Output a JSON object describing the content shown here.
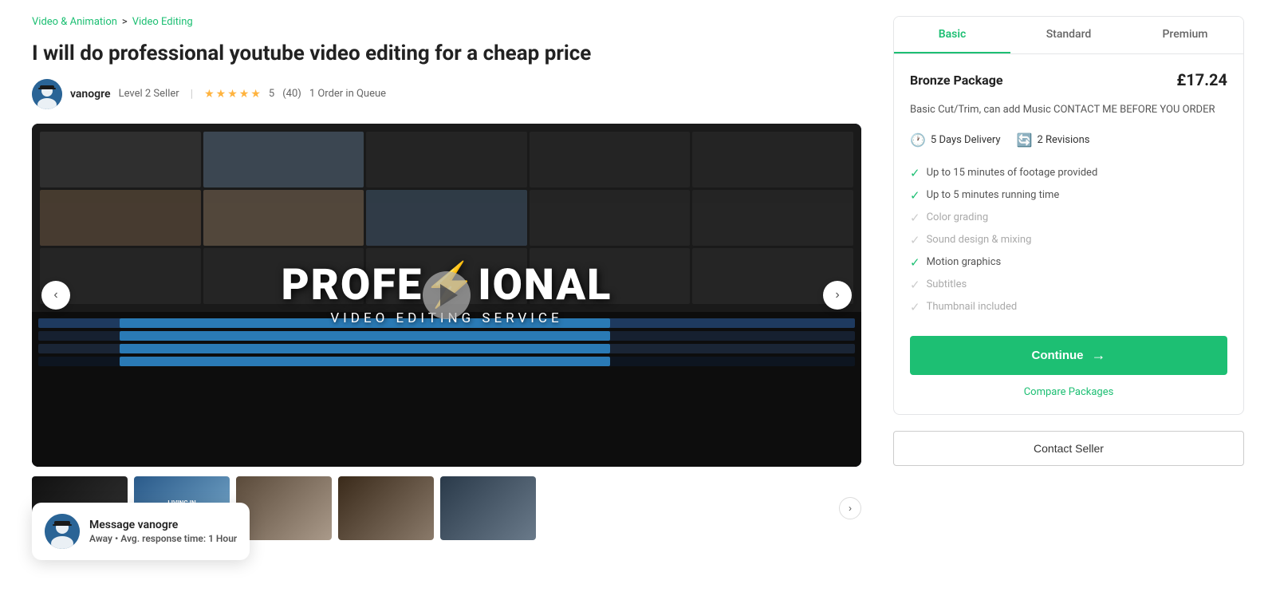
{
  "breadcrumb": {
    "parent": "Video & Animation",
    "child": "Video Editing",
    "separator": ">"
  },
  "gig": {
    "title": "I will do professional youtube video editing for a cheap price"
  },
  "seller": {
    "name": "vanogre",
    "level": "Level 2 Seller",
    "rating": "5",
    "review_count": "(40)",
    "orders_queue": "1 Order in Queue"
  },
  "stars": [
    "★",
    "★",
    "★",
    "★",
    "★"
  ],
  "media": {
    "pro_line1": "PROFE",
    "bolt": "⚡",
    "pro_line1b": "IONAL",
    "sub_text": "VIDEO EDITING SERVICE"
  },
  "nav": {
    "left_arrow": "‹",
    "right_arrow": "›"
  },
  "tabs": [
    {
      "id": "basic",
      "label": "Basic",
      "active": true
    },
    {
      "id": "standard",
      "label": "Standard",
      "active": false
    },
    {
      "id": "premium",
      "label": "Premium",
      "active": false
    }
  ],
  "package": {
    "name": "Bronze Package",
    "price": "£17.24",
    "description": "Basic Cut/Trim, can add Music   CONTACT ME BEFORE YOU ORDER",
    "delivery_days": "5 Days Delivery",
    "revisions": "2 Revisions",
    "delivery_icon": "🕐",
    "revision_icon": "🔄",
    "features": [
      {
        "label": "Up to 15 minutes of footage provided",
        "included": true
      },
      {
        "label": "Up to 5 minutes running time",
        "included": true
      },
      {
        "label": "Color grading",
        "included": false
      },
      {
        "label": "Sound design & mixing",
        "included": false
      },
      {
        "label": "Motion graphics",
        "included": true
      },
      {
        "label": "Subtitles",
        "included": false
      },
      {
        "label": "Thumbnail included",
        "included": false
      }
    ],
    "continue_label": "Continue",
    "continue_arrow": "→",
    "compare_label": "Compare Packages"
  },
  "contact": {
    "button_label": "Contact Seller"
  },
  "message_box": {
    "title": "Message vanogre",
    "status": "Away",
    "response": "Avg. response time:",
    "response_time": "1 Hour"
  },
  "thumbnails": [
    {
      "label": ""
    },
    {
      "label": "LIVING IN\nSIMPSONVILLE"
    },
    {
      "label": ""
    },
    {
      "label": ""
    },
    {
      "label": ""
    }
  ],
  "thumb_nav_arrow": "›"
}
